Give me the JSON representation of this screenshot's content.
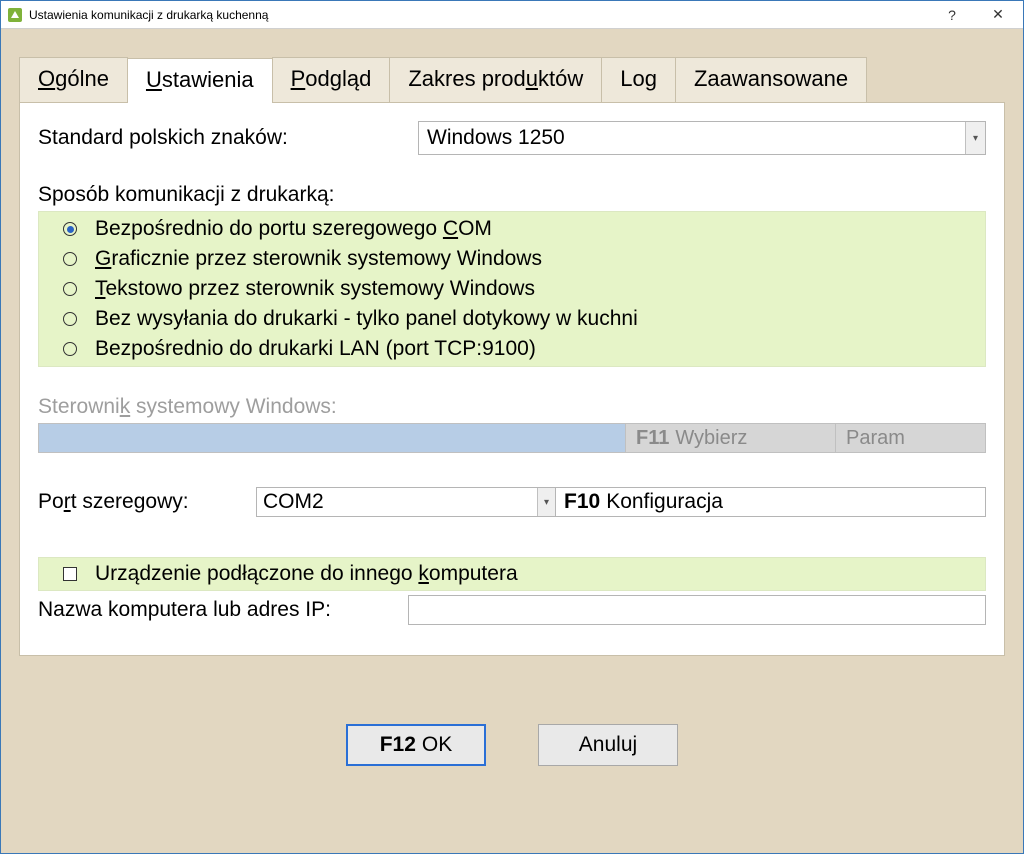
{
  "window": {
    "title": "Ustawienia komunikacji z drukarką kuchenną",
    "help_glyph": "?",
    "close_glyph": "✕"
  },
  "tabs": {
    "t0": {
      "pre": "",
      "u": "O",
      "post": "gólne"
    },
    "t1": {
      "pre": "",
      "u": "U",
      "post": "stawienia"
    },
    "t2": {
      "pre": "",
      "u": "P",
      "post": "odgląd"
    },
    "t3": {
      "pre": "Zakres prod",
      "u": "u",
      "post": "któw"
    },
    "t4": {
      "pre": "",
      "u": "",
      "post": "Log"
    },
    "t5": {
      "pre": "",
      "u": "",
      "post": "Zaawansowane"
    },
    "active_index": 1
  },
  "encoding": {
    "label_pre": "",
    "label_u": "S",
    "label_post": "tandard polskich znaków:",
    "value": "Windows 1250"
  },
  "comm": {
    "title": "Sposób komunikacji z drukarką:",
    "options": [
      {
        "pre": "Bezpośrednio do portu szeregowego ",
        "u": "C",
        "post": "OM",
        "selected": true
      },
      {
        "pre": "",
        "u": "G",
        "post": "raficznie przez sterownik systemowy Windows",
        "selected": false
      },
      {
        "pre": "",
        "u": "T",
        "post": "ekstowo przez sterownik systemowy Windows",
        "selected": false
      },
      {
        "pre": "Bez wysyłania do drukarki - tylko panel dotykowy w kuchni",
        "u": "",
        "post": "",
        "selected": false
      },
      {
        "pre": "Bezpośrednio do drukarki LAN (port TCP:9100)",
        "u": "",
        "post": "",
        "selected": false
      }
    ]
  },
  "driver": {
    "label_pre": "Sterowni",
    "label_u": "k",
    "label_post": " systemowy Windows:",
    "btn1_bold": "F11",
    "btn1_text": "Wybierz",
    "btn2_text": "Param"
  },
  "serial": {
    "label_pre": "Po",
    "label_u": "r",
    "label_post": "t szeregowy:",
    "value": "COM2",
    "btn_bold": "F10",
    "btn_text": "Konfiguracja"
  },
  "remote": {
    "chk_pre": "Urządzenie podłączone do innego ",
    "chk_u": "k",
    "chk_post": "omputera",
    "addr_label": "Nazwa komputera lub adres IP:"
  },
  "footer": {
    "ok_bold": "F12",
    "ok_text": "OK",
    "cancel_text": "Anuluj"
  }
}
